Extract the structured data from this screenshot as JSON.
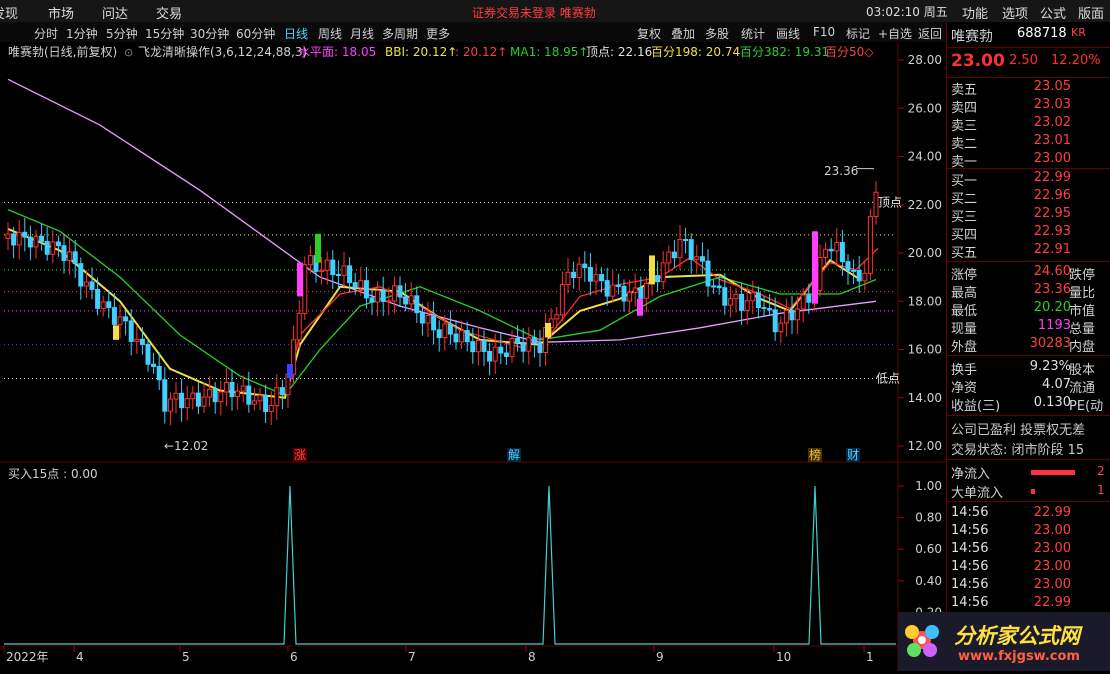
{
  "menu": {
    "items": [
      "发现",
      "市场",
      "问达",
      "交易"
    ],
    "status": "证券交易未登录   唯赛勃",
    "clock": "03:02:10 周五",
    "right_items": [
      "功能",
      "选项",
      "公式",
      "版面"
    ]
  },
  "periods": [
    "分时",
    "1分钟",
    "5分钟",
    "15分钟",
    "30分钟",
    "60分钟",
    "日线",
    "周线",
    "月线",
    "多周期",
    "更多"
  ],
  "active_period": "日线",
  "tools": [
    "复权",
    "叠加",
    "多股",
    "统计",
    "画线",
    "F10",
    "标记",
    "+自选",
    "返回"
  ],
  "main_chart": {
    "header": {
      "name": "唯赛勃(日线,前复权)",
      "indicator": "飞龙清晰操作(3,6,12,24,88,3)",
      "items": [
        {
          "label": "水平面: 18.05",
          "color": "#ff40ff"
        },
        {
          "label": "BBI: 20.12↑",
          "color": "#f0e040"
        },
        {
          "label": ": 20.12↑",
          "color": "#ff4040"
        },
        {
          "label": "MA1: 18.95↑",
          "color": "#28d028"
        },
        {
          "label": "顶点: 22.16",
          "color": "#e0e0e0"
        },
        {
          "label": "百分198: 20.74",
          "color": "#f0e040"
        },
        {
          "label": "百分382: 19.31",
          "color": "#28d028"
        },
        {
          "label": "百分50◇",
          "color": "#ff4040"
        }
      ]
    },
    "price_axis": [
      "28.00",
      "26.00",
      "24.00",
      "22.00",
      "20.00",
      "18.00",
      "16.00",
      "14.00",
      "12.00"
    ],
    "annotations": {
      "high": "23.36",
      "low": "←12.02",
      "top": "顶点",
      "bottom": "低点"
    },
    "markers": [
      {
        "text": "涨",
        "color": "#ff4040",
        "bg": "#550000"
      },
      {
        "text": "解",
        "color": "#5ad0ff",
        "bg": "#002a44"
      },
      {
        "text": "榜",
        "color": "#f0c040",
        "bg": "#443300"
      },
      {
        "text": "财",
        "color": "#5ad0ff",
        "bg": "#002a44"
      }
    ]
  },
  "sub_chart": {
    "title": "买入15点 : 0.00",
    "axis": [
      "1.00",
      "0.80",
      "0.60",
      "0.40",
      "0.20"
    ]
  },
  "x_axis": [
    "2022年",
    "4",
    "5",
    "6",
    "7",
    "8",
    "9",
    "10",
    "1"
  ],
  "quote": {
    "name": "唯赛勃",
    "code": "688718",
    "badge": "KR",
    "price": "23.00",
    "change": "2.50",
    "pct": "12.20%",
    "asks": [
      {
        "label": "卖五",
        "price": "23.05"
      },
      {
        "label": "卖四",
        "price": "23.03"
      },
      {
        "label": "卖三",
        "price": "23.02"
      },
      {
        "label": "卖二",
        "price": "23.01"
      },
      {
        "label": "卖一",
        "price": "23.00"
      }
    ],
    "bids": [
      {
        "label": "买一",
        "price": "22.99"
      },
      {
        "label": "买二",
        "price": "22.96"
      },
      {
        "label": "买三",
        "price": "22.95"
      },
      {
        "label": "买四",
        "price": "22.93"
      },
      {
        "label": "买五",
        "price": "22.91"
      }
    ],
    "stats": [
      {
        "label": "涨停",
        "value": "24.60",
        "label2": "跌停",
        "cls": ""
      },
      {
        "label": "最高",
        "value": "23.36",
        "label2": "量比",
        "cls": ""
      },
      {
        "label": "最低",
        "value": "20.20",
        "label2": "市值",
        "cls": "green"
      },
      {
        "label": "现量",
        "value": "1193",
        "label2": "总量",
        "cls": "mag"
      },
      {
        "label": "外盘",
        "value": "30283",
        "label2": "内盘",
        "cls": ""
      }
    ],
    "stats2": [
      {
        "label": "换手",
        "value": "9.23%",
        "label2": "股本"
      },
      {
        "label": "净资",
        "value": "4.07",
        "label2": "流通"
      },
      {
        "label": "收益(三)",
        "value": "0.130",
        "label2": "PE(动"
      }
    ],
    "info": [
      "公司已盈利 投票权无差",
      "交易状态: 闭市阶段 15"
    ],
    "flow": [
      {
        "label": "净流入",
        "value": "2"
      },
      {
        "label": "大单流入",
        "value": "1"
      }
    ],
    "ticks": [
      {
        "time": "14:56",
        "price": "22.99"
      },
      {
        "time": "14:56",
        "price": "23.00"
      },
      {
        "time": "14:56",
        "price": "23.00"
      },
      {
        "time": "14:56",
        "price": "23.00"
      },
      {
        "time": "14:56",
        "price": "23.00"
      },
      {
        "time": "14:56",
        "price": "22.99"
      }
    ]
  },
  "logo": {
    "text": "分析家公式网",
    "url": "www.fxjgsw.com"
  }
}
